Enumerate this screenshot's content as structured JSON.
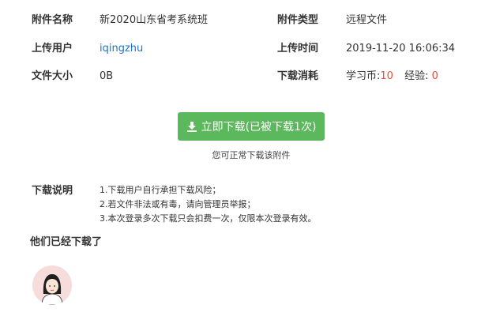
{
  "info": {
    "attachment_name_label": "附件名称",
    "attachment_name": "新2020山东省考系统班",
    "attachment_type_label": "附件类型",
    "attachment_type": "远程文件",
    "uploader_label": "上传用户",
    "uploader": "iqingzhu",
    "upload_time_label": "上传时间",
    "upload_time": "2019-11-20 16:06:34",
    "file_size_label": "文件大小",
    "file_size": "0B",
    "download_cost_label": "下载消耗",
    "coins_label": "学习币:",
    "coins_value": "10",
    "exp_label": "经验:",
    "exp_value": "0"
  },
  "download": {
    "button_label": "立即下载(已被下载1次)",
    "icon": "download-icon",
    "note": "您可正常下载该附件"
  },
  "notes": {
    "title": "下载说明",
    "lines": [
      "1.下载用户自行承担下载风险；",
      "2.若文件非法或有毒，请向管理员举报；",
      "3.本次登录多次下载只会扣费一次，仅限本次登录有效。"
    ]
  },
  "downloaded": {
    "title": "他们已经下载了",
    "avatar_icon": "user-avatar-icon"
  },
  "colors": {
    "button": "#5cb85c",
    "link": "#1a73c9",
    "highlight": "#e84c3d"
  }
}
